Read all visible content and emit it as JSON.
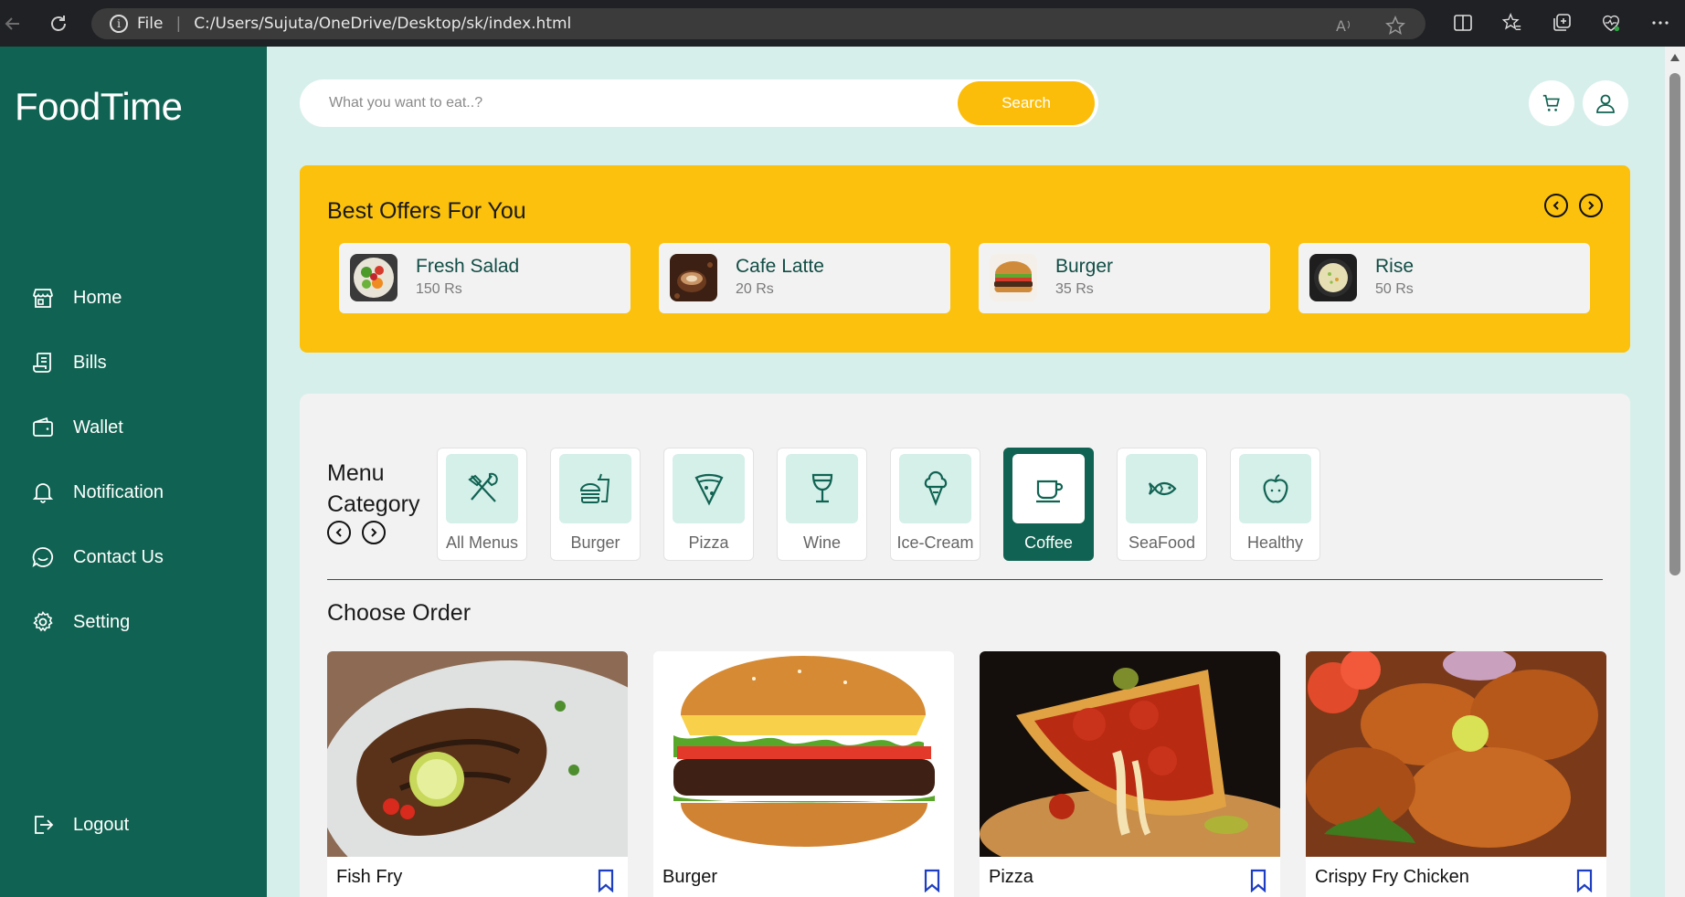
{
  "browser": {
    "scheme_label": "File",
    "url": "C:/Users/Sujuta/OneDrive/Desktop/sk/index.html"
  },
  "sidebar": {
    "logo": "FoodTime",
    "items": [
      {
        "label": "Home",
        "icon": "store-icon"
      },
      {
        "label": "Bills",
        "icon": "receipt-icon"
      },
      {
        "label": "Wallet",
        "icon": "wallet-icon"
      },
      {
        "label": "Notification",
        "icon": "bell-icon"
      },
      {
        "label": "Contact Us",
        "icon": "chat-icon"
      },
      {
        "label": "Setting",
        "icon": "gear-icon"
      }
    ],
    "logout": "Logout"
  },
  "search": {
    "placeholder": "What you want to eat..?",
    "button": "Search"
  },
  "offers": {
    "title": "Best Offers For You",
    "items": [
      {
        "name": "Fresh Salad",
        "price": "150 Rs"
      },
      {
        "name": "Cafe Latte",
        "price": "20 Rs"
      },
      {
        "name": "Burger",
        "price": "35 Rs"
      },
      {
        "name": "Rise",
        "price": "50 Rs"
      }
    ]
  },
  "menu": {
    "title_line1": "Menu",
    "title_line2": "Category",
    "categories": [
      {
        "label": "All Menus",
        "icon": "fork-knife-icon"
      },
      {
        "label": "Burger",
        "icon": "fastfood-icon"
      },
      {
        "label": "Pizza",
        "icon": "pizza-icon"
      },
      {
        "label": "Wine",
        "icon": "wine-glass-icon"
      },
      {
        "label": "Ice-Cream",
        "icon": "ice-cream-icon"
      },
      {
        "label": "Coffee",
        "icon": "coffee-cup-icon",
        "active": true
      },
      {
        "label": "SeaFood",
        "icon": "fish-icon"
      },
      {
        "label": "Healthy",
        "icon": "apple-icon"
      }
    ]
  },
  "choose_order": {
    "title": "Choose Order",
    "items": [
      {
        "name": "Fish Fry"
      },
      {
        "name": "Burger"
      },
      {
        "name": "Pizza"
      },
      {
        "name": "Crispy Fry Chicken"
      }
    ]
  },
  "colors": {
    "brand_green": "#106352",
    "accent_yellow": "#fbc10c",
    "background": "#d7efeb"
  }
}
